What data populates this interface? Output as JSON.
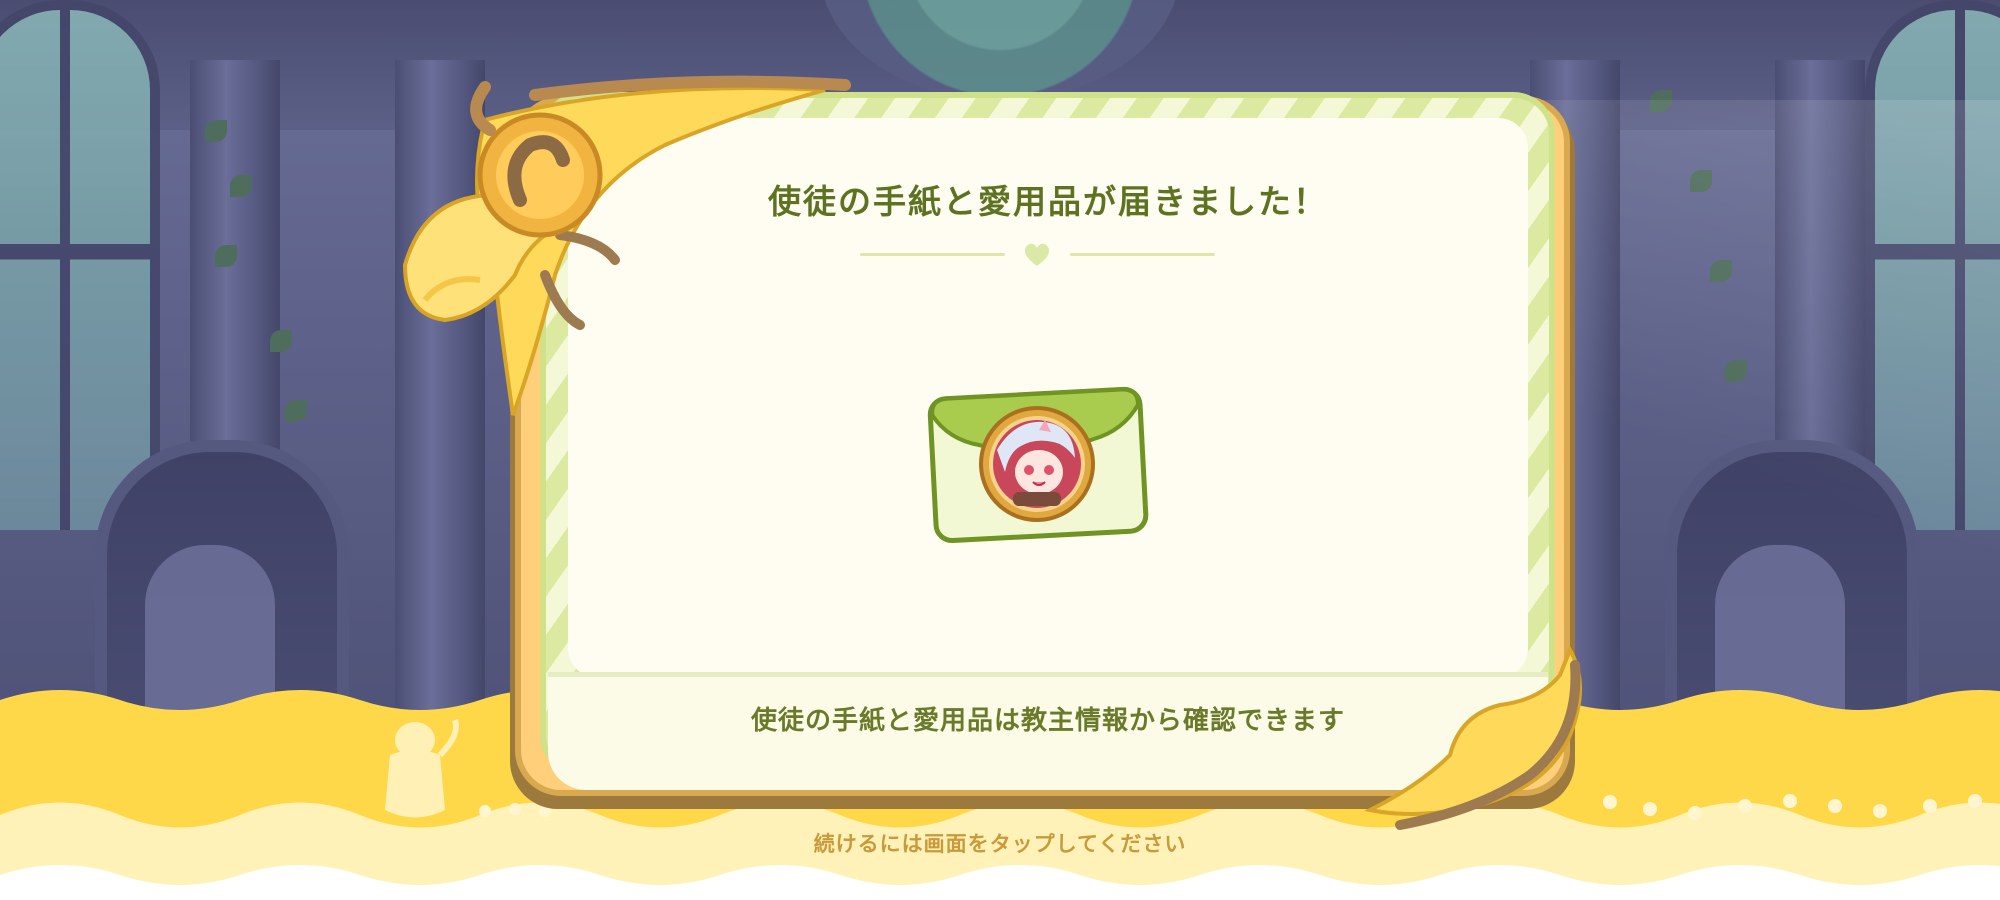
{
  "dialog": {
    "title": "使徒の手紙と愛用品が届きました！",
    "info_text": "使徒の手紙と愛用品は教主情報から確認できます",
    "item": {
      "icon": "letter-envelope-icon",
      "portrait": "apostle-portrait-icon"
    }
  },
  "prompt": {
    "tap_text": "続けるには画面をタップしてください"
  },
  "colors": {
    "title_green": "#5d7321",
    "card_border_yellow": "#ffcf79",
    "envelope_green": "#a9cc4f",
    "wave_yellow": "#ffd84a",
    "tap_text": "#c99a3a"
  }
}
